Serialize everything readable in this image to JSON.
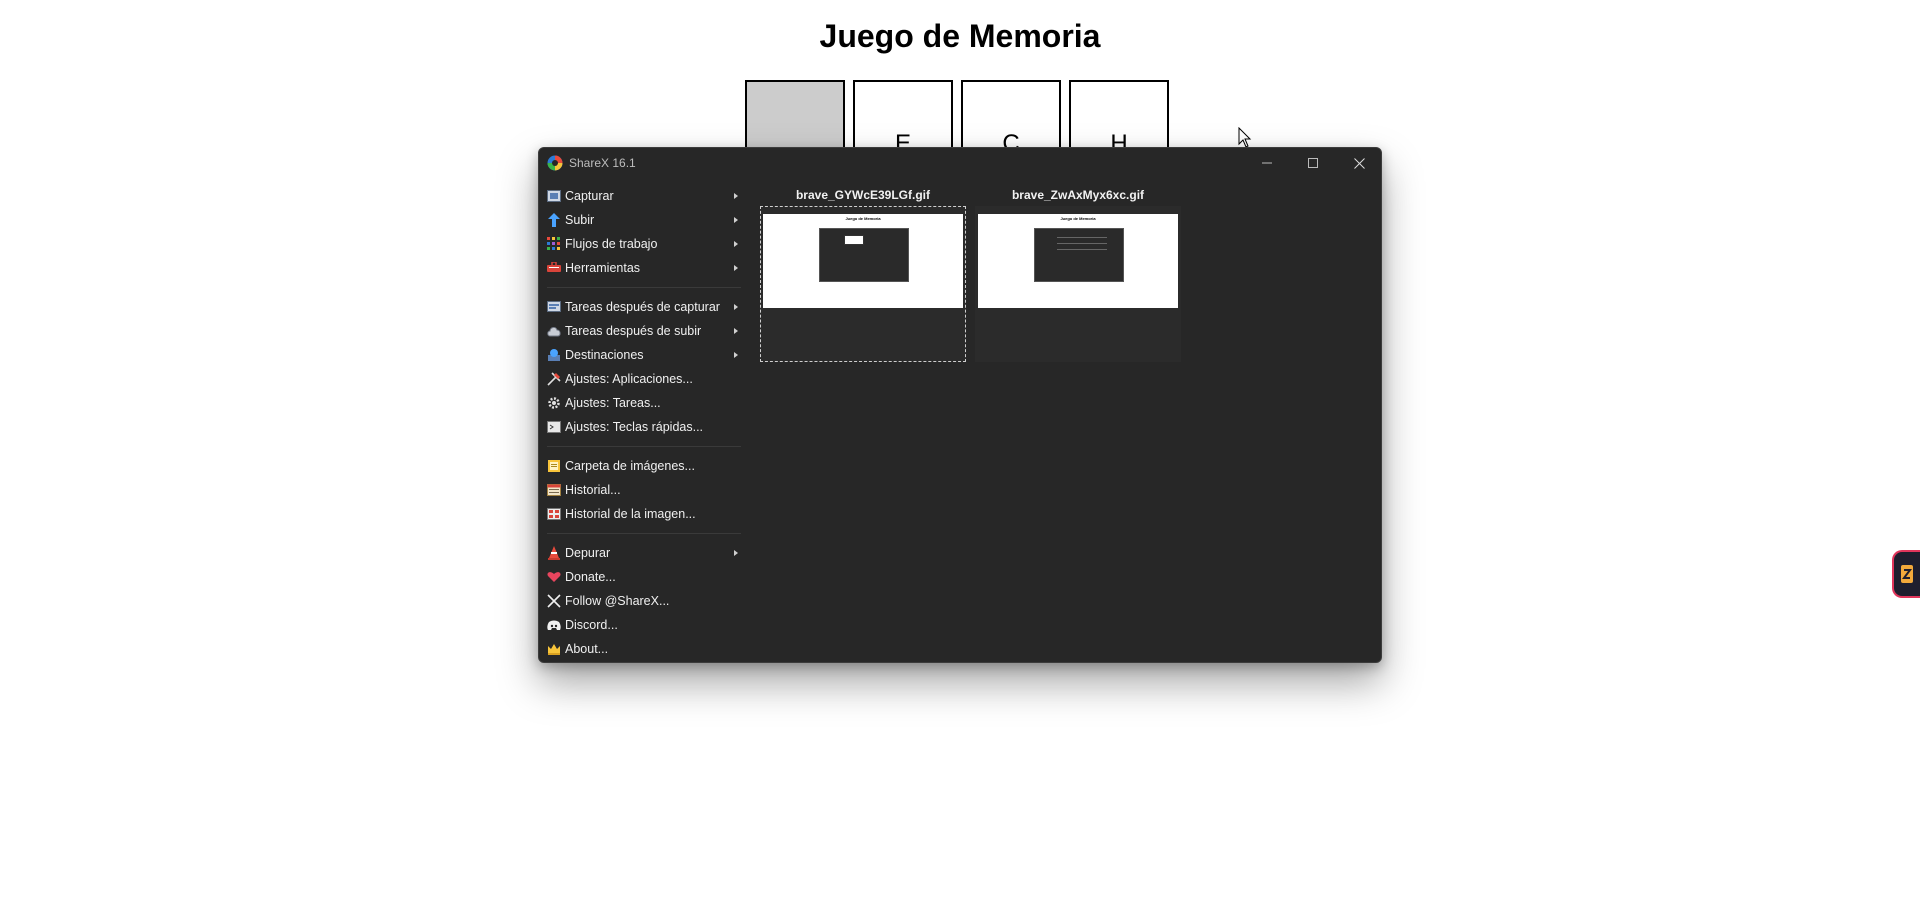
{
  "page": {
    "title": "Juego de Memoria",
    "cards": [
      {
        "face": "",
        "revealed": false
      },
      {
        "face": "E",
        "revealed": true
      },
      {
        "face": "C",
        "revealed": true
      },
      {
        "face": "H",
        "revealed": true
      }
    ]
  },
  "sharex": {
    "window_title": "ShareX 16.1",
    "menu": [
      {
        "label": "Capturar",
        "icon": "capture-icon",
        "submenu": true
      },
      {
        "label": "Subir",
        "icon": "upload-arrow-icon",
        "submenu": true
      },
      {
        "label": "Flujos de trabajo",
        "icon": "workflows-grid-icon",
        "submenu": true
      },
      {
        "label": "Herramientas",
        "icon": "tools-icon",
        "submenu": true
      },
      {
        "label": "Tareas después de capturar",
        "icon": "after-capture-icon",
        "submenu": true
      },
      {
        "label": "Tareas después de subir",
        "icon": "after-upload-cloud-icon",
        "submenu": true
      },
      {
        "label": "Destinaciones",
        "icon": "destinations-icon",
        "submenu": true
      },
      {
        "label": "Ajustes: Aplicaciones...",
        "icon": "app-settings-icon",
        "submenu": false
      },
      {
        "label": "Ajustes: Tareas...",
        "icon": "task-settings-gear-icon",
        "submenu": false
      },
      {
        "label": "Ajustes: Teclas rápidas...",
        "icon": "hotkey-settings-icon",
        "submenu": false
      },
      {
        "label": "Carpeta de imágenes...",
        "icon": "image-folder-icon",
        "submenu": false
      },
      {
        "label": "Historial...",
        "icon": "history-icon",
        "submenu": false
      },
      {
        "label": "Historial de la imagen...",
        "icon": "image-history-icon",
        "submenu": false
      },
      {
        "label": "Depurar",
        "icon": "debug-cone-icon",
        "submenu": true
      },
      {
        "label": "Donate...",
        "icon": "heart-icon",
        "submenu": false
      },
      {
        "label": "Follow @ShareX...",
        "icon": "x-logo-icon",
        "submenu": false
      },
      {
        "label": "Discord...",
        "icon": "discord-icon",
        "submenu": false
      },
      {
        "label": "About...",
        "icon": "crown-icon",
        "submenu": false
      }
    ],
    "thumbnails": [
      {
        "filename": "brave_GYWcE39LGf.gif",
        "selected": true,
        "preview_title": "Juego de Memoria"
      },
      {
        "filename": "brave_ZwAxMyx6xc.gif",
        "selected": false,
        "preview_title": "Juego de Memoria"
      }
    ]
  },
  "colors": {
    "window_bg": "#272727",
    "card_hidden": "#cccccc",
    "side_tab_border": "#e0355b"
  }
}
